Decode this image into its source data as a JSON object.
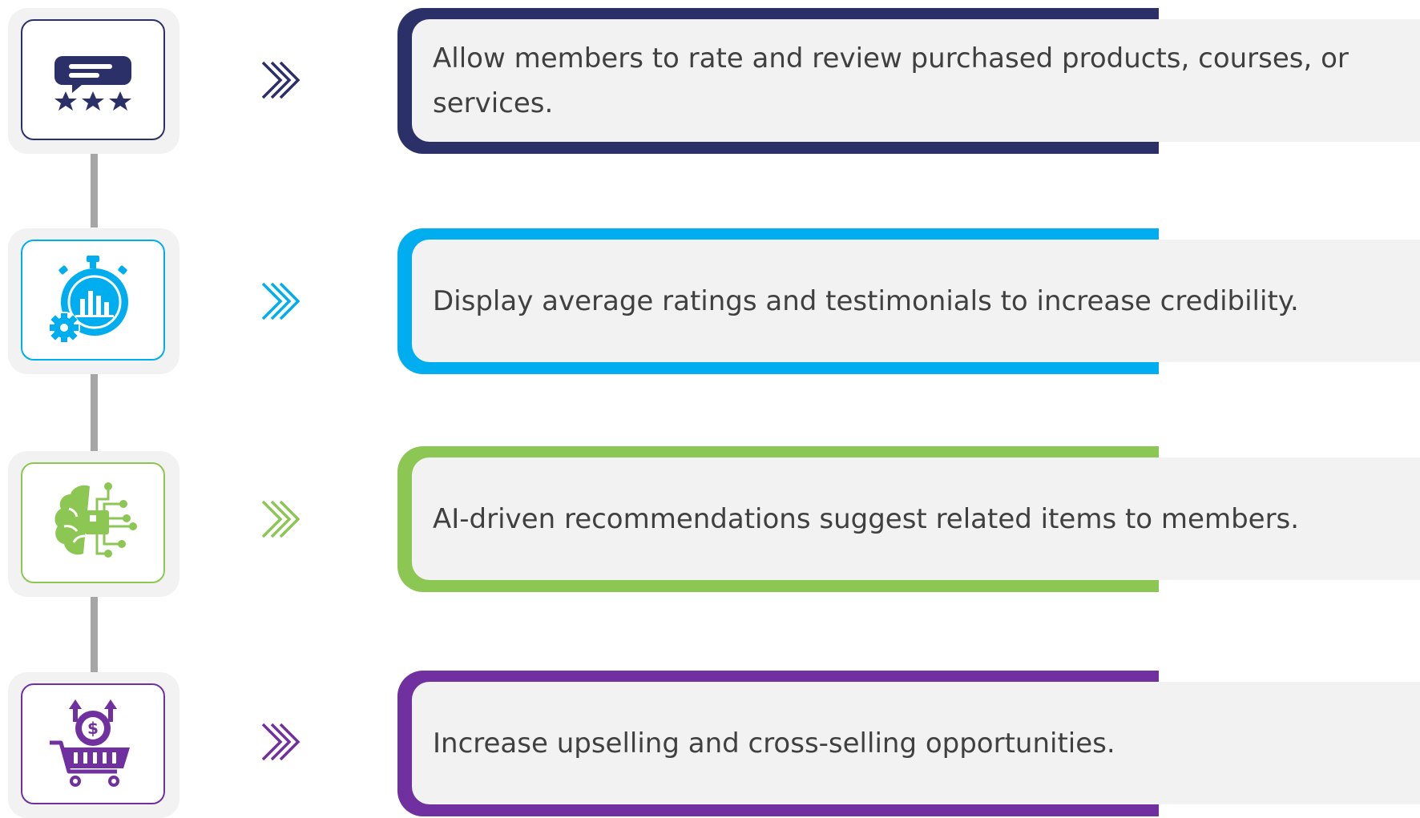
{
  "colors": {
    "navy": "#2b3068",
    "sky": "#00aeef",
    "green": "#8cc653",
    "purple": "#7030a0",
    "connector": "#a6a6a6",
    "panel": "#f2f2f2",
    "text": "#404040"
  },
  "steps": [
    {
      "icon": "rating-review-icon",
      "text": "Allow members to rate and review purchased products, courses, or services."
    },
    {
      "icon": "stopwatch-gear-chart-icon",
      "text": "Display average ratings and testimonials to increase credibility."
    },
    {
      "icon": "ai-brain-circuit-icon",
      "text": "AI-driven recommendations suggest related items to members."
    },
    {
      "icon": "shopping-cart-dollar-icon",
      "text": "Increase upselling and cross-selling opportunities."
    }
  ]
}
